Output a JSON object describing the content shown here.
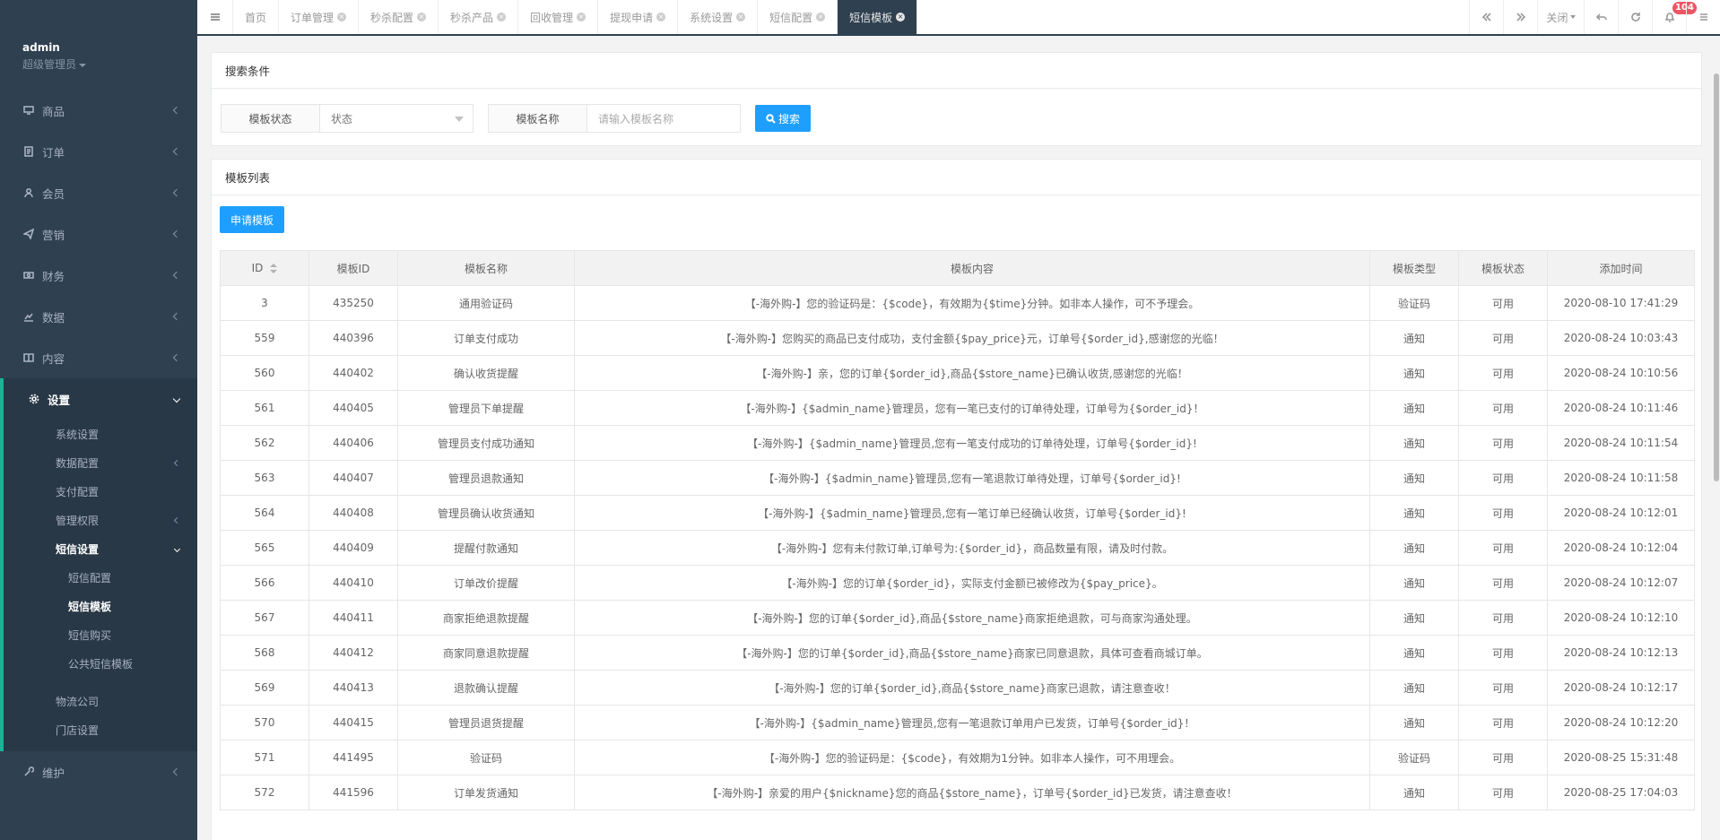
{
  "sidebar": {
    "user": "admin",
    "role": "超级管理员",
    "menu": [
      {
        "label": "商品",
        "icon": "monitor-icon"
      },
      {
        "label": "订单",
        "icon": "document-icon"
      },
      {
        "label": "会员",
        "icon": "user-icon"
      },
      {
        "label": "营销",
        "icon": "send-icon"
      },
      {
        "label": "财务",
        "icon": "money-icon"
      },
      {
        "label": "数据",
        "icon": "chart-icon"
      },
      {
        "label": "内容",
        "icon": "book-icon"
      }
    ],
    "settings": {
      "label": "设置",
      "items": [
        "系统设置",
        "数据配置",
        "支付配置",
        "管理权限",
        "短信设置"
      ],
      "sms_sub": [
        "短信配置",
        "短信模板",
        "短信购买",
        "公共短信模板"
      ],
      "more": [
        "物流公司",
        "门店设置"
      ]
    },
    "maintain": "维护"
  },
  "tabs": [
    "首页",
    "订单管理",
    "秒杀配置",
    "秒杀产品",
    "回收管理",
    "提现申请",
    "系统设置",
    "短信配置",
    "短信模板"
  ],
  "toolbar": {
    "close_label": "关闭",
    "notify_count": "104"
  },
  "search": {
    "title": "搜索条件",
    "status_label": "模板状态",
    "status_value": "状态",
    "name_label": "模板名称",
    "name_placeholder": "请输入模板名称",
    "search_btn": "搜索"
  },
  "list": {
    "title": "模板列表",
    "apply_btn": "申请模板",
    "headers": [
      "ID",
      "模板ID",
      "模板名称",
      "模板内容",
      "模板类型",
      "模板状态",
      "添加时间"
    ],
    "rows": [
      [
        "3",
        "435250",
        "通用验证码",
        "【-海外购-】您的验证码是：{$code}，有效期为{$time}分钟。如非本人操作，可不予理会。",
        "验证码",
        "可用",
        "2020-08-10 17:41:29"
      ],
      [
        "559",
        "440396",
        "订单支付成功",
        "【-海外购-】您购买的商品已支付成功，支付金额{$pay_price}元，订单号{$order_id},感谢您的光临！",
        "通知",
        "可用",
        "2020-08-24 10:03:43"
      ],
      [
        "560",
        "440402",
        "确认收货提醒",
        "【-海外购-】亲，您的订单{$order_id},商品{$store_name}已确认收货,感谢您的光临！",
        "通知",
        "可用",
        "2020-08-24 10:10:56"
      ],
      [
        "561",
        "440405",
        "管理员下单提醒",
        "【-海外购-】{$admin_name}管理员，您有一笔已支付的订单待处理，订单号为{$order_id}！",
        "通知",
        "可用",
        "2020-08-24 10:11:46"
      ],
      [
        "562",
        "440406",
        "管理员支付成功通知",
        "【-海外购-】{$admin_name}管理员,您有一笔支付成功的订单待处理，订单号{$order_id}!",
        "通知",
        "可用",
        "2020-08-24 10:11:54"
      ],
      [
        "563",
        "440407",
        "管理员退款通知",
        "【-海外购-】{$admin_name}管理员,您有一笔退款订单待处理，订单号{$order_id}!",
        "通知",
        "可用",
        "2020-08-24 10:11:58"
      ],
      [
        "564",
        "440408",
        "管理员确认收货通知",
        "【-海外购-】{$admin_name}管理员,您有一笔订单已经确认收货，订单号{$order_id}!",
        "通知",
        "可用",
        "2020-08-24 10:12:01"
      ],
      [
        "565",
        "440409",
        "提醒付款通知",
        "【-海外购-】您有未付款订单,订单号为:{$order_id}，商品数量有限，请及时付款。",
        "通知",
        "可用",
        "2020-08-24 10:12:04"
      ],
      [
        "566",
        "440410",
        "订单改价提醒",
        "【-海外购-】您的订单{$order_id}，实际支付金额已被修改为{$pay_price}。",
        "通知",
        "可用",
        "2020-08-24 10:12:07"
      ],
      [
        "567",
        "440411",
        "商家拒绝退款提醒",
        "【-海外购-】您的订单{$order_id},商品{$store_name}商家拒绝退款，可与商家沟通处理。",
        "通知",
        "可用",
        "2020-08-24 10:12:10"
      ],
      [
        "568",
        "440412",
        "商家同意退款提醒",
        "【-海外购-】您的订单{$order_id},商品{$store_name}商家已同意退款，具体可查看商城订单。",
        "通知",
        "可用",
        "2020-08-24 10:12:13"
      ],
      [
        "569",
        "440413",
        "退款确认提醒",
        "【-海外购-】您的订单{$order_id},商品{$store_name}商家已退款，请注意查收！",
        "通知",
        "可用",
        "2020-08-24 10:12:17"
      ],
      [
        "570",
        "440415",
        "管理员退货提醒",
        "【-海外购-】{$admin_name}管理员,您有一笔退款订单用户已发货，订单号{$order_id}！",
        "通知",
        "可用",
        "2020-08-24 10:12:20"
      ],
      [
        "571",
        "441495",
        "验证码",
        "【-海外购-】您的验证码是：{$code}，有效期为1分钟。如非本人操作，可不用理会。",
        "验证码",
        "可用",
        "2020-08-25 15:31:48"
      ],
      [
        "572",
        "441596",
        "订单发货通知",
        "【-海外购-】亲爱的用户{$nickname}您的商品{$store_name}，订单号{$order_id}已发货，请注意查收！",
        "通知",
        "可用",
        "2020-08-25 17:04:03"
      ]
    ]
  }
}
